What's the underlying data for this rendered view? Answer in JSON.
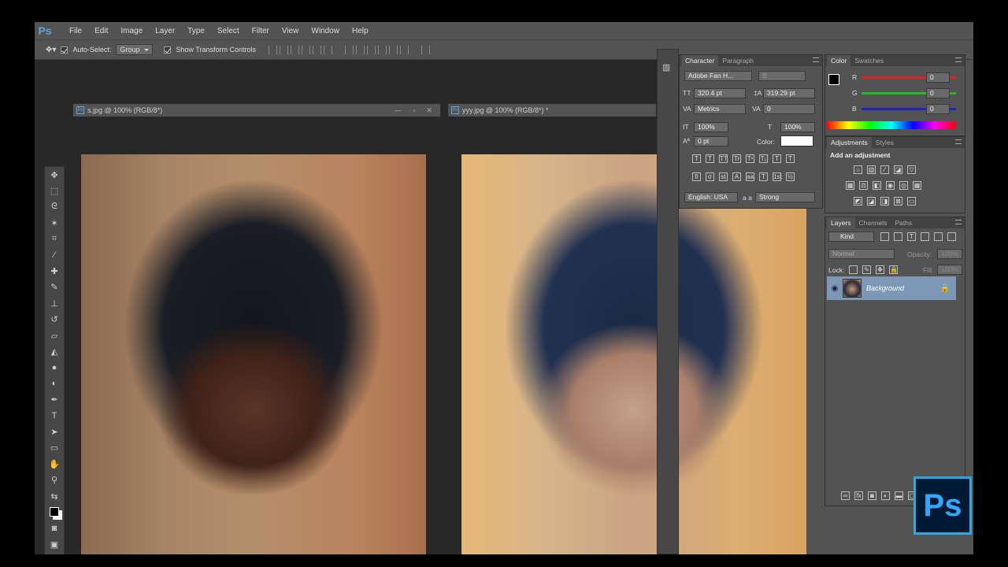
{
  "app": {
    "logo": "Ps",
    "menu": [
      "File",
      "Edit",
      "Image",
      "Layer",
      "Type",
      "Select",
      "Filter",
      "View",
      "Window",
      "Help"
    ]
  },
  "options": {
    "auto_select_label": "Auto-Select:",
    "auto_select_value": "Group",
    "transform_label": "Show Transform Controls"
  },
  "doc1": {
    "title": "s.jpg @ 100% (RGB/8*)"
  },
  "doc2": {
    "title": "yyy.jpg @ 100% (RGB/8*) *"
  },
  "character": {
    "tab_character": "Character",
    "tab_paragraph": "Paragraph",
    "font_family": "Adobe Fan H...",
    "font_style": "B",
    "font_size": "320.4 pt",
    "leading": "319.29 pt",
    "kerning": "Metrics",
    "tracking": "0",
    "vertical_scale": "100%",
    "horizontal_scale": "100%",
    "baseline_shift": "0 pt",
    "color_label": "Color:",
    "language": "English: USA",
    "aa_label": "a a",
    "antialias": "Strong"
  },
  "color_panel": {
    "tab_color": "Color",
    "tab_swatches": "Swatches",
    "r_label": "R",
    "r_value": "0",
    "g_label": "G",
    "g_value": "0",
    "b_label": "B",
    "b_value": "0"
  },
  "adjustments": {
    "tab_adjustments": "Adjustments",
    "tab_styles": "Styles",
    "heading": "Add an adjustment"
  },
  "layers": {
    "tab_layers": "Layers",
    "tab_channels": "Channels",
    "tab_paths": "Paths",
    "kind": "Kind",
    "blend_mode": "Normal",
    "opacity_label": "Opacity:",
    "opacity_value": "100%",
    "lock_label": "Lock:",
    "fill_label": "Fill:",
    "fill_value": "100%",
    "layer_name": "Background"
  },
  "badge": {
    "text": "Ps"
  },
  "colors": {
    "accent": "#31a8ff",
    "panel": "#535353",
    "canvas": "#282828"
  }
}
